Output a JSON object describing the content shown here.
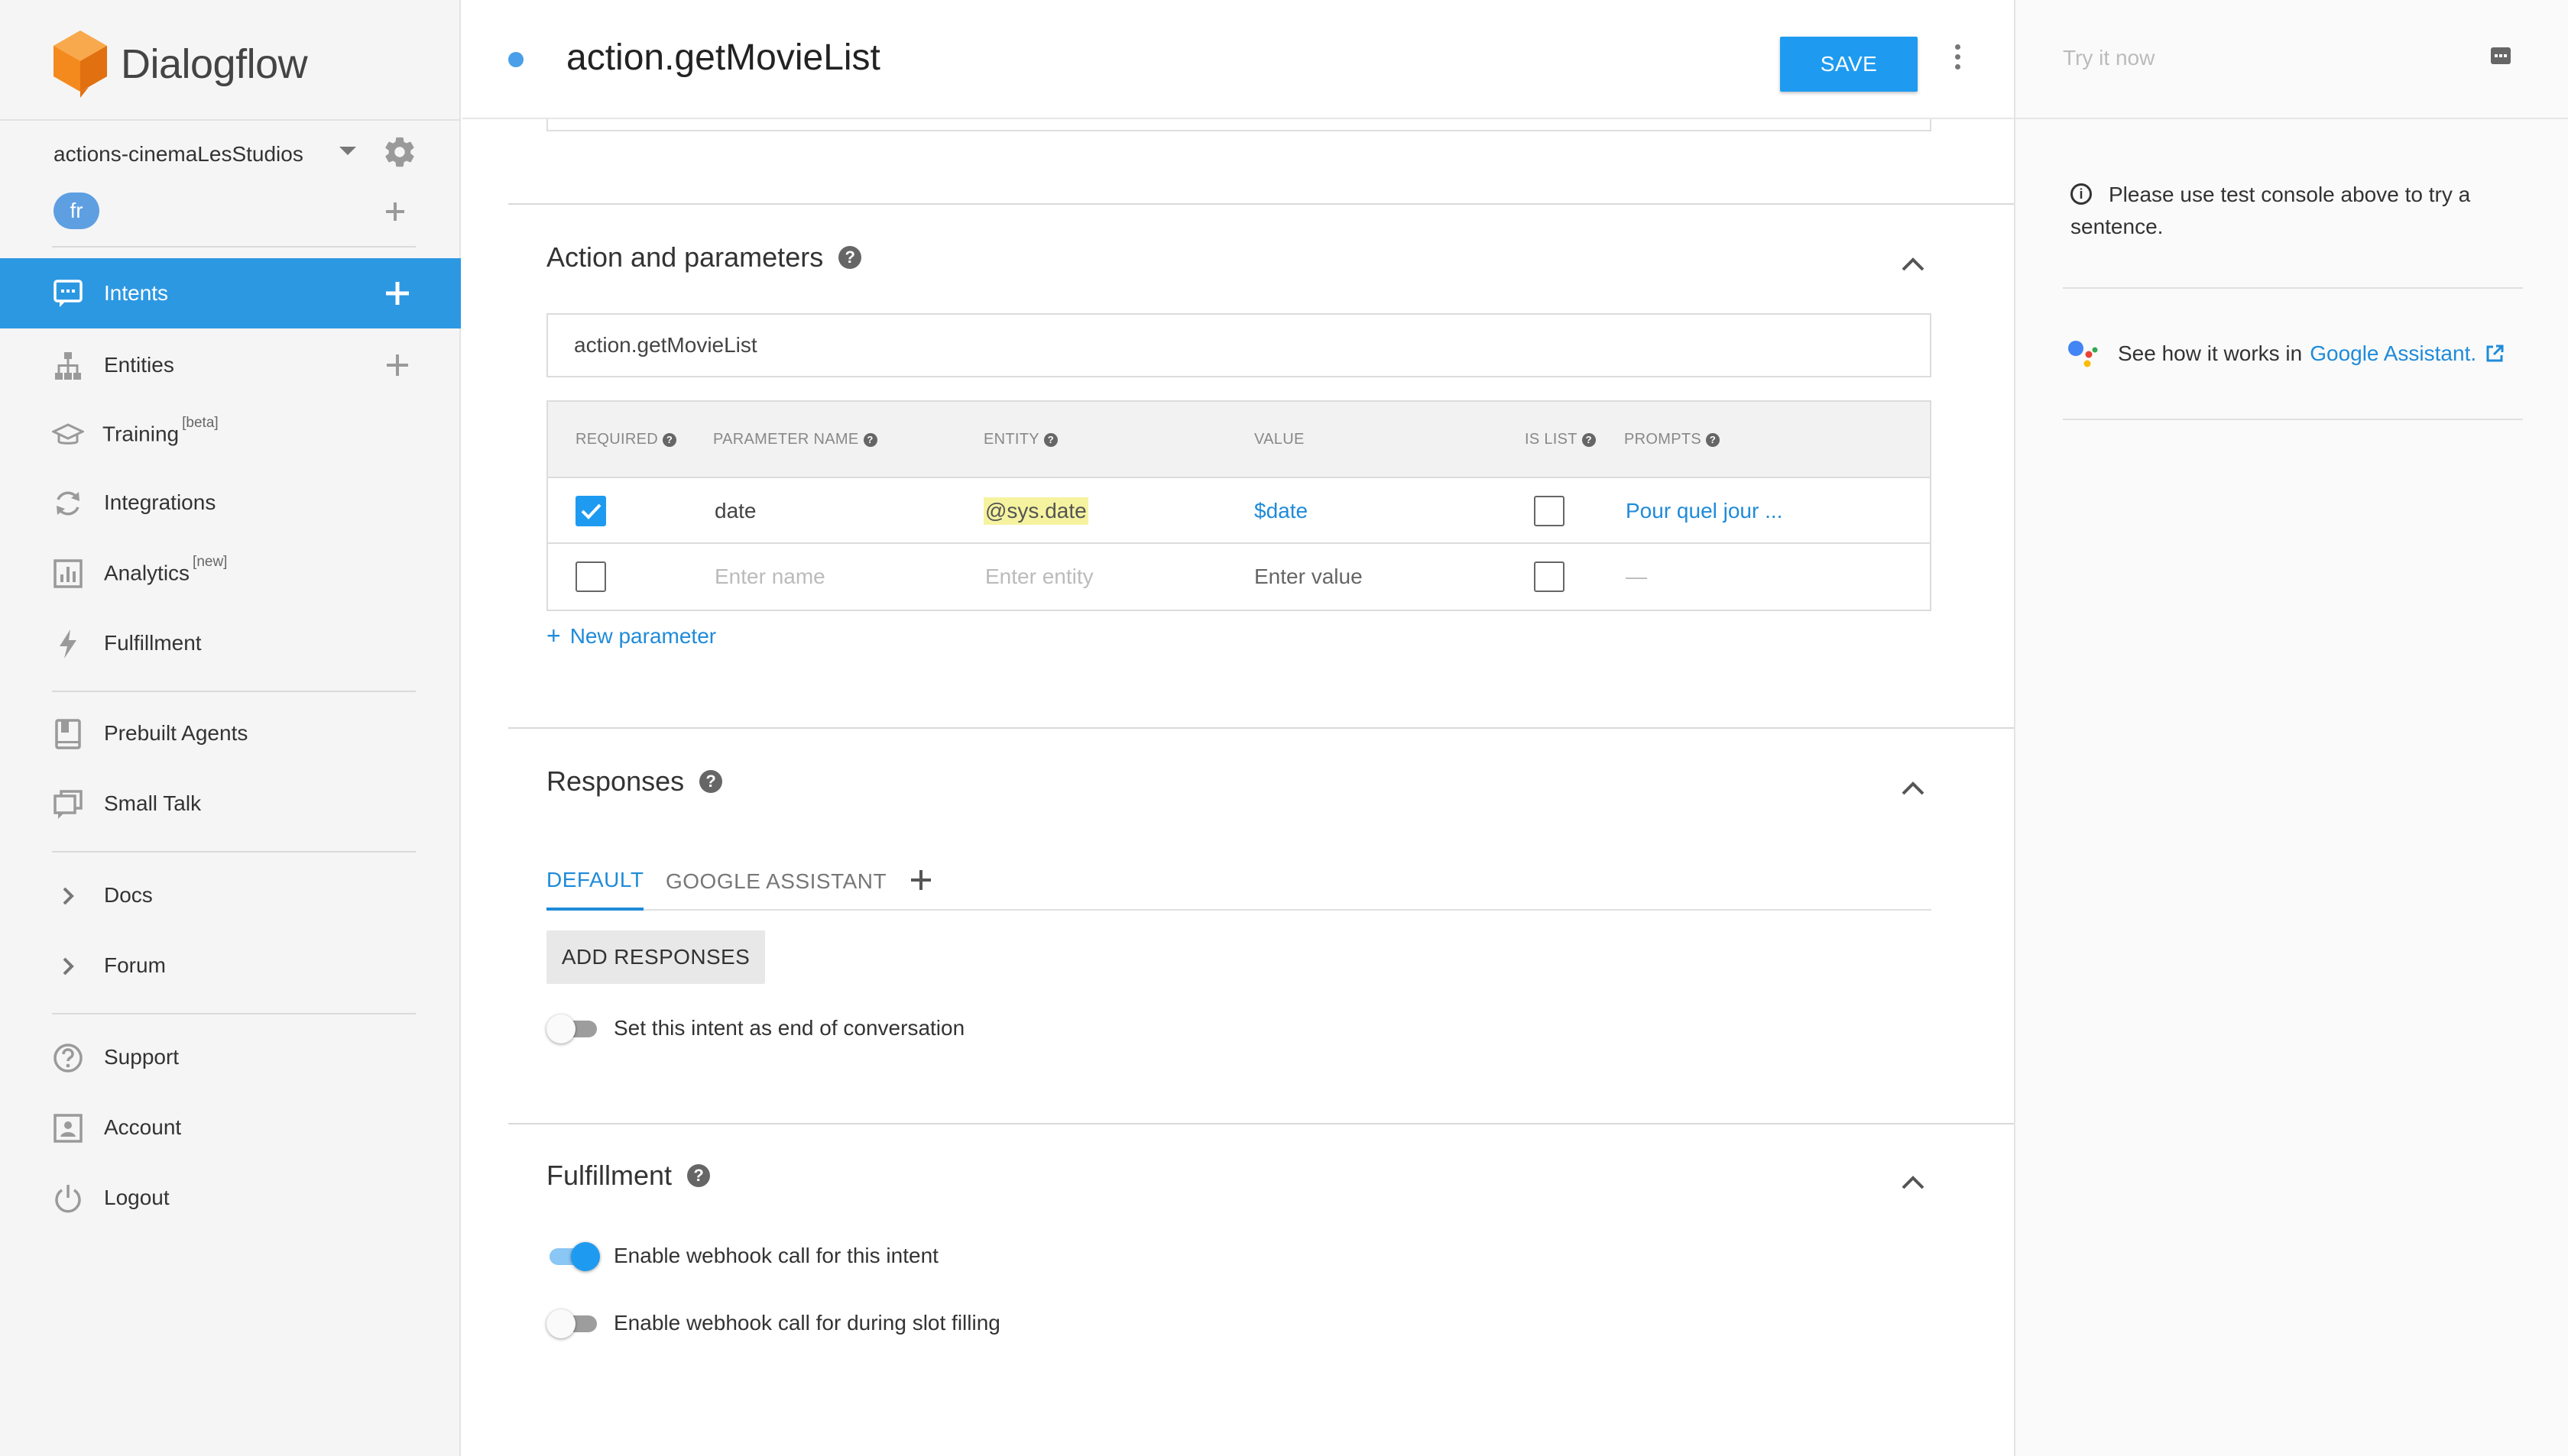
{
  "app": {
    "name": "Dialogflow"
  },
  "agent": {
    "name": "actions-cinemaLesStudios",
    "language": "fr"
  },
  "nav": {
    "intents": "Intents",
    "entities": "Entities",
    "training": "Training",
    "training_badge": "[beta]",
    "integrations": "Integrations",
    "analytics": "Analytics",
    "analytics_badge": "[new]",
    "fulfillment": "Fulfillment",
    "prebuilt": "Prebuilt Agents",
    "smalltalk": "Small Talk",
    "docs": "Docs",
    "forum": "Forum",
    "support": "Support",
    "account": "Account",
    "logout": "Logout"
  },
  "header": {
    "intent_name": "action.getMovieList",
    "save_label": "SAVE"
  },
  "action_section": {
    "title": "Action and parameters",
    "action_value": "action.getMovieList",
    "columns": {
      "required": "REQUIRED",
      "parameter_name": "PARAMETER NAME",
      "entity": "ENTITY",
      "value": "VALUE",
      "is_list": "IS LIST",
      "prompts": "PROMPTS"
    },
    "rows": [
      {
        "required": true,
        "name": "date",
        "entity": "@sys.date",
        "value": "$date",
        "is_list": false,
        "prompts": "Pour quel jour ..."
      }
    ],
    "empty_row": {
      "name_placeholder": "Enter name",
      "entity_placeholder": "Enter entity",
      "value_placeholder": "Enter value",
      "prompts": "—"
    },
    "new_parameter": "New parameter"
  },
  "responses_section": {
    "title": "Responses",
    "tabs": [
      "DEFAULT",
      "GOOGLE ASSISTANT"
    ],
    "active_tab": "DEFAULT",
    "add_responses": "ADD RESPONSES",
    "end_conversation_label": "Set this intent as end of conversation",
    "end_conversation_on": false
  },
  "fulfillment_section": {
    "title": "Fulfillment",
    "webhook_label": "Enable webhook call for this intent",
    "webhook_on": true,
    "slot_filling_label": "Enable webhook call for during slot filling",
    "slot_filling_on": false
  },
  "right_panel": {
    "try_placeholder": "Try it now",
    "info_text": "Please use test console above to try a sentence.",
    "ga_text": "See how it works in",
    "ga_link": "Google Assistant."
  },
  "colors": {
    "accent": "#2d98e2",
    "save": "#1e9bf0",
    "link": "#1f8bd9",
    "entity_highlight": "#f6f3a0",
    "logo_orange": "#f48a1e"
  }
}
